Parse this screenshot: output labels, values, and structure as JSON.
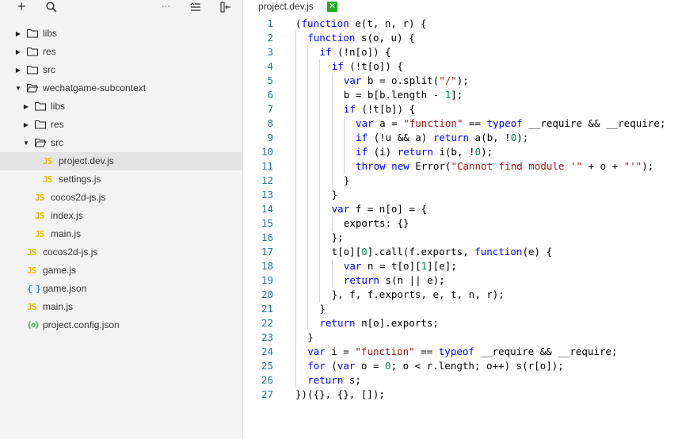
{
  "toolbar": {
    "add_label": "+",
    "search_icon": "search-icon",
    "more_label": "···",
    "collapse_icon": "collapse-icon",
    "split_icon": "split-icon"
  },
  "tree": [
    {
      "label": "libs",
      "type": "folder",
      "depth": 0,
      "expanded": false
    },
    {
      "label": "res",
      "type": "folder",
      "depth": 0,
      "expanded": false
    },
    {
      "label": "src",
      "type": "folder",
      "depth": 0,
      "expanded": false
    },
    {
      "label": "wechatgame-subcontext",
      "type": "folder",
      "depth": 0,
      "expanded": true
    },
    {
      "label": "libs",
      "type": "folder",
      "depth": 1,
      "expanded": false
    },
    {
      "label": "res",
      "type": "folder",
      "depth": 1,
      "expanded": false
    },
    {
      "label": "src",
      "type": "folder",
      "depth": 1,
      "expanded": true
    },
    {
      "label": "project.dev.js",
      "type": "js",
      "depth": 2,
      "selected": true
    },
    {
      "label": "settings.js",
      "type": "js",
      "depth": 2
    },
    {
      "label": "cocos2d-js.js",
      "type": "js",
      "depth": 1
    },
    {
      "label": "index.js",
      "type": "js",
      "depth": 1
    },
    {
      "label": "main.js",
      "type": "js",
      "depth": 1
    },
    {
      "label": "cocos2d-js.js",
      "type": "js",
      "depth": 0
    },
    {
      "label": "game.js",
      "type": "js",
      "depth": 0
    },
    {
      "label": "game.json",
      "type": "json",
      "depth": 0
    },
    {
      "label": "main.js",
      "type": "js",
      "depth": 0
    },
    {
      "label": "project.config.json",
      "type": "config",
      "depth": 0
    }
  ],
  "icons": {
    "js": "JS",
    "json": "{ }",
    "config": "{o}"
  },
  "editor": {
    "tab_title": "project.dev.js",
    "tab_close": "✕",
    "lines": [
      {
        "n": "1",
        "indent": 0,
        "t": "(function e(t, n, r) {"
      },
      {
        "n": "2",
        "indent": 1,
        "t": "function s(o, u) {"
      },
      {
        "n": "3",
        "indent": 2,
        "t": "if (!n[o]) {"
      },
      {
        "n": "4",
        "indent": 3,
        "t": "if (!t[o]) {"
      },
      {
        "n": "5",
        "indent": 4,
        "t": "var b = o.split(\"/\");"
      },
      {
        "n": "6",
        "indent": 4,
        "t": "b = b[b.length - 1];"
      },
      {
        "n": "7",
        "indent": 4,
        "t": "if (!t[b]) {"
      },
      {
        "n": "8",
        "indent": 5,
        "t": "var a = \"function\" == typeof __require && __require;"
      },
      {
        "n": "9",
        "indent": 5,
        "t": "if (!u && a) return a(b, !0);"
      },
      {
        "n": "10",
        "indent": 5,
        "t": "if (i) return i(b, !0);"
      },
      {
        "n": "11",
        "indent": 5,
        "t": "throw new Error(\"Cannot find module '\" + o + \"'\");"
      },
      {
        "n": "12",
        "indent": 4,
        "t": "}"
      },
      {
        "n": "13",
        "indent": 3,
        "t": "}"
      },
      {
        "n": "14",
        "indent": 3,
        "t": "var f = n[o] = {"
      },
      {
        "n": "15",
        "indent": 4,
        "t": "exports: {}"
      },
      {
        "n": "16",
        "indent": 3,
        "t": "};"
      },
      {
        "n": "17",
        "indent": 3,
        "t": "t[o][0].call(f.exports, function(e) {"
      },
      {
        "n": "18",
        "indent": 4,
        "t": "var n = t[o][1][e];"
      },
      {
        "n": "19",
        "indent": 4,
        "t": "return s(n || e);"
      },
      {
        "n": "20",
        "indent": 3,
        "t": "}, f, f.exports, e, t, n, r);"
      },
      {
        "n": "21",
        "indent": 2,
        "t": "}"
      },
      {
        "n": "22",
        "indent": 2,
        "t": "return n[o].exports;"
      },
      {
        "n": "23",
        "indent": 1,
        "t": "}"
      },
      {
        "n": "24",
        "indent": 1,
        "t": "var i = \"function\" == typeof __require && __require;"
      },
      {
        "n": "25",
        "indent": 1,
        "t": "for (var o = 0; o < r.length; o++) s(r[o]);"
      },
      {
        "n": "26",
        "indent": 1,
        "t": "return s;"
      },
      {
        "n": "27",
        "indent": 0,
        "t": "})({}, {}, []);"
      }
    ]
  },
  "colors": {
    "keyword": "#0000ff",
    "string": "#a31515",
    "number": "#098658",
    "line_number": "#237893",
    "js_icon": "#e6b800",
    "json_icon": "#2a8bd6",
    "config_icon": "#3aa84a",
    "tab_close_bg": "#1aad19"
  }
}
